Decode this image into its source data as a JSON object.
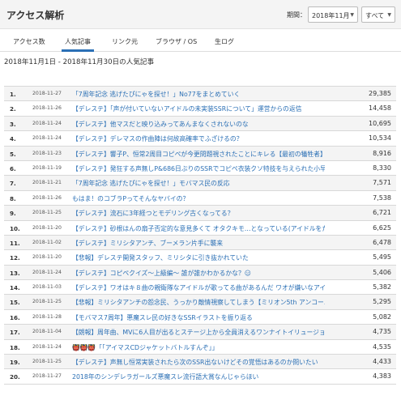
{
  "header": {
    "title": "アクセス解析",
    "period_label": "期間：",
    "month_select": "2018年11月",
    "filter_select": "すべて"
  },
  "tabs": [
    {
      "label": "アクセス数"
    },
    {
      "label": "人気記事"
    },
    {
      "label": "リンク元"
    },
    {
      "label": "ブラウザ / OS"
    },
    {
      "label": "生ログ"
    }
  ],
  "active_tab": "人気記事",
  "range_heading": "2018年11月1日 - 2018年11月30日の人気記事",
  "articles": [
    {
      "rank": "1.",
      "date": "2018-11-27",
      "title": "「7周年記念 逃げたぴにゃを探せ！」No77をまとめていく",
      "count": "29,385"
    },
    {
      "rank": "2.",
      "date": "2018-11-26",
      "title": "【デレステ】「声が付いていないアイドルの未実装SSRについて」運営からの返信",
      "count": "14,458"
    },
    {
      "rank": "3.",
      "date": "2018-11-24",
      "title": "【デレステ】他マスだと映り込みってあんまなくされないのな",
      "count": "10,695"
    },
    {
      "rank": "4.",
      "date": "2018-11-24",
      "title": "【デレステ】デレマスの作曲陣は何故高確率でふざけるの？",
      "count": "10,534"
    },
    {
      "rank": "5.",
      "date": "2018-11-23",
      "title": "【デレステ】響子P、恒常2周目コピペが今更問題視されたことにキレる【最初の犠牲者】",
      "count": "8,916"
    },
    {
      "rank": "6.",
      "date": "2018-11-19",
      "title": "【デレステ】発狂する声無しP&686日ぶりのSSRでコピペ衣装クソ特技を与えられた小早川…",
      "count": "8,330"
    },
    {
      "rank": "7.",
      "date": "2018-11-21",
      "title": "「7周年記念 逃げたぴにゃを探せ！」モバマス民の反応",
      "count": "7,571"
    },
    {
      "rank": "8.",
      "date": "2018-11-26",
      "title": "もはま！のコブラPってそんなヤバイの？",
      "count": "7,538"
    },
    {
      "rank": "9.",
      "date": "2018-11-25",
      "title": "【デレステ】流石に3年経つとモデリング古くなってる？",
      "count": "6,721"
    },
    {
      "rank": "10.",
      "date": "2018-11-20",
      "title": "【デレステ】砂根はんの扇子否定的な意見多くて オタクキモ…となっている(アイドルをた…",
      "count": "6,625"
    },
    {
      "rank": "11.",
      "date": "2018-11-02",
      "title": "【デレステ】ミリシタアンチ、ブーメラン片手に襲来",
      "count": "6,478"
    },
    {
      "rank": "12.",
      "date": "2018-11-20",
      "title": "【悲報】デレステ開発スタッフ、ミリシタに引き抜かれていた",
      "count": "5,495"
    },
    {
      "rank": "13.",
      "date": "2018-11-24",
      "title": "【デレステ】コピペクイズ〜上級編〜 誰が誰かわかるかな？😑",
      "count": "5,406"
    },
    {
      "rank": "14.",
      "date": "2018-11-03",
      "title": "【デレステ】ワオはキ８曲の親衛隊なアイドルが歌ってる曲があるんだ ワオが嫌いなアイドル…",
      "count": "5,382"
    },
    {
      "rank": "15.",
      "date": "2018-11-25",
      "title": "【悲報】ミリシタアンチの怨念民、うっかり敵情視察してしまう【ミリオン5th アンコール…",
      "count": "5,295"
    },
    {
      "rank": "16.",
      "date": "2018-11-28",
      "title": "【モバマス7周年】悪魔スレ民の好きなSSRイラストを振り返る",
      "count": "5,082"
    },
    {
      "rank": "17.",
      "date": "2018-11-04",
      "title": "【朗報】周年曲、MVに6人目が出るとステージ上から全員消えるワンナイトイリュージョン…",
      "count": "4,735"
    },
    {
      "rank": "18.",
      "date": "2018-11-24",
      "title": "👹👹👹「「アイマスCDジャケットバトルすんぞ」」",
      "count": "4,535"
    },
    {
      "rank": "19.",
      "date": "2018-11-25",
      "title": "【デレステ】声無し恒常実装されたら次のSSR出ないけどその覚悟はあるのか問いたい",
      "count": "4,433"
    },
    {
      "rank": "20.",
      "date": "2018-11-27",
      "title": "2018年のシンデレラガールズ悪魔スレ流行語大賞なんじゃらほい",
      "count": "4,383"
    }
  ]
}
